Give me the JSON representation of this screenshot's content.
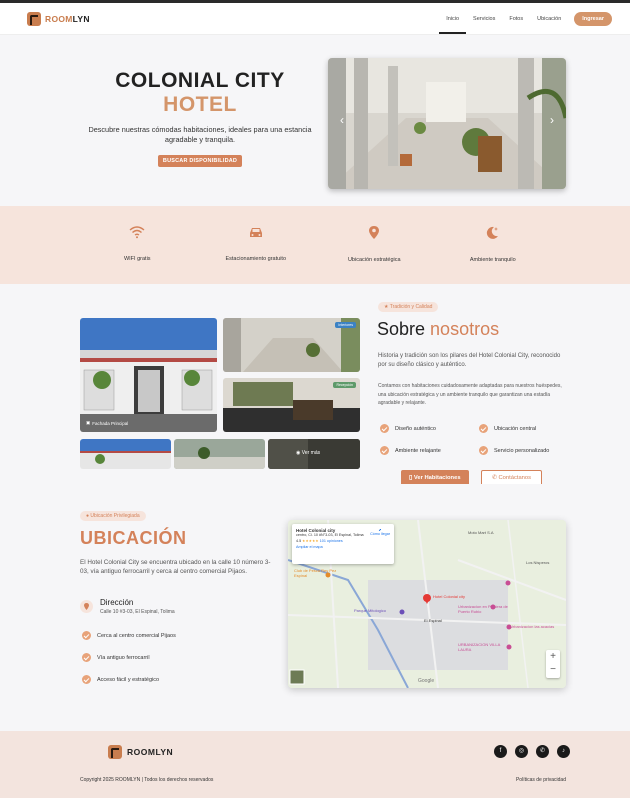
{
  "brand": {
    "first": "ROOM",
    "second": "LYN"
  },
  "nav": {
    "items": [
      "Inicio",
      "Servicios",
      "Fotos",
      "Ubicación"
    ],
    "login": "Ingresar"
  },
  "hero": {
    "line1": "COLONIAL CITY",
    "line2": "HOTEL",
    "desc": "Descubre nuestras cómodas habitaciones, ideales para una estancia agradable y tranquila.",
    "button": "BUSCAR DISPONIBILIDAD"
  },
  "features": [
    "WIFI gratis",
    "Estacionamiento gratuito",
    "Ubicación estratégica",
    "Ambiente tranquilo"
  ],
  "about": {
    "badge": "Tradición y Calidad",
    "title_a": "Sobre ",
    "title_b": "nosotros",
    "p1": "Historia y tradición son los pilares del Hotel Colonial City, reconocido por su diseño clásico y auténtico.",
    "p2": "Contamos con habitaciones cuidadosamente adaptadas para nuestros huéspedes, una ubicación estratégica y un ambiente tranquilo que garantizan una estadía agradable y relajante.",
    "checks": [
      "Diseño auténtico",
      "Ubicación central",
      "Ambiente relajante",
      "Servicio personalizado"
    ],
    "btn1": "Ver Habitaciones",
    "btn2": "Contáctanos",
    "gallery": {
      "main_label": "Fachada Principal",
      "tag1": "Interiores",
      "tag2": "Recepción",
      "more": "Ver más"
    }
  },
  "location": {
    "badge": "Ubicación Privilegiada",
    "title": "UBICACIÓN",
    "desc": "El Hotel Colonial City se encuentra ubicado en la calle 10 número 3-03, vía antiguo ferrocarril y cerca al centro comercial Pijaos.",
    "addr_title": "Dirección",
    "addr": "Calle 10 #3-03, El Espinal, Tolima",
    "items": [
      "Cerca al centro comercial Pijaos",
      "Vía antiguo ferrocarril",
      "Acceso fácil y estratégico"
    ],
    "map": {
      "card_title": "Hotel Colonial city",
      "card_addr": "centro, Cl. 10 #N°3-03, El Espinal, Tolima",
      "rating": "4.5",
      "reviews": "101 opiniones",
      "link": "Ampliar el mapa",
      "directions": "Cómo llegar",
      "labels": [
        "Los Nisperos",
        "Club de Pesca Rey Pez Espinal",
        "Parque Mitologico",
        "El Espinal",
        "Hotel Colonial city",
        "Urbanizacion en Pradera de Puerto Rubio",
        "Urbanizacion las acacias",
        "URBANIZACION VILLA LAURA",
        "Moto Mart S.A",
        "Google"
      ]
    }
  },
  "footer": {
    "copy": "Copyright 2025 ROOMLYN | Todos los derechos reservados",
    "privacy": "Políticas de privacidad"
  }
}
